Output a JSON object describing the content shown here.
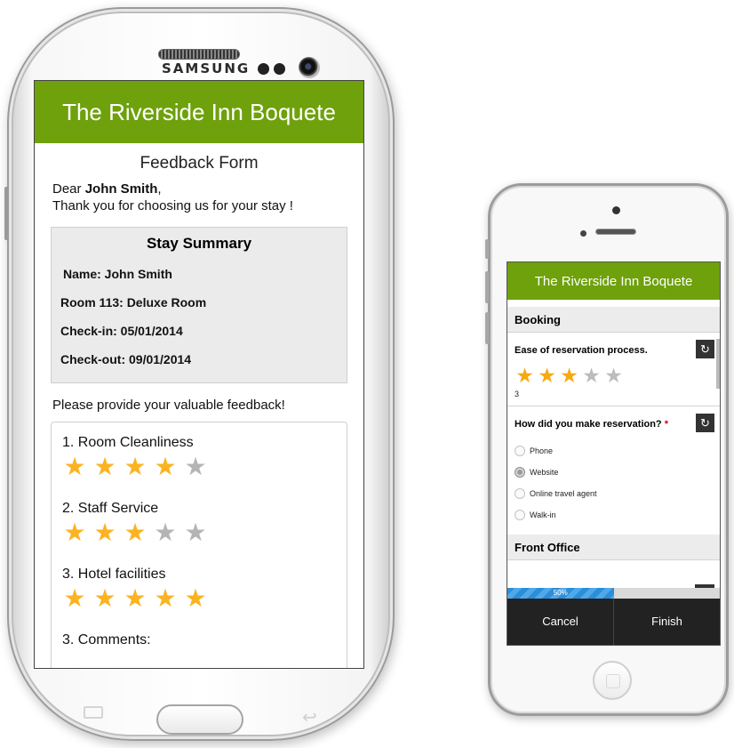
{
  "samsung": {
    "brand": "SAMSUNG",
    "header_title": "The Riverside Inn Boquete",
    "form_title": "Feedback Form",
    "greeting_prefix": "Dear ",
    "guest_name": "John Smith",
    "greeting_suffix": ",",
    "thank_you": "Thank you for choosing us for your stay !",
    "summary": {
      "title": "Stay Summary",
      "name": "Name: John Smith",
      "room": "Room 113: Deluxe Room",
      "checkin": "Check-in: 05/01/2014",
      "checkout": "Check-out: 09/01/2014"
    },
    "prompt": "Please provide your valuable feedback!",
    "questions": [
      {
        "label": "1. Room Cleanliness",
        "rating": 4,
        "max": 5
      },
      {
        "label": "2. Staff Service",
        "rating": 3,
        "max": 5
      },
      {
        "label": "3. Hotel facilities",
        "rating": 5,
        "max": 5
      }
    ],
    "comments_label": "3. Comments:"
  },
  "iphone": {
    "header_title": "The Riverside Inn Boquete",
    "section_booking": "Booking",
    "q1": {
      "title": "Ease of reservation process.",
      "rating": 3,
      "max": 5,
      "value_text": "3"
    },
    "q2": {
      "title": "How did you make reservation?",
      "required_mark": "*",
      "options": [
        "Phone",
        "Website",
        "Online travel agent",
        "Walk-in"
      ],
      "selected": "Website"
    },
    "section_front_office": "Front Office",
    "progress": {
      "value": 50,
      "label": "50%"
    },
    "cancel_label": "Cancel",
    "finish_label": "Finish",
    "reset_icon": "refresh-icon"
  },
  "colors": {
    "header_green": "#6ea10c",
    "star_on": "#fbb321",
    "star_off": "#b4b4b4",
    "progress_blue": "#2b8ed8"
  }
}
